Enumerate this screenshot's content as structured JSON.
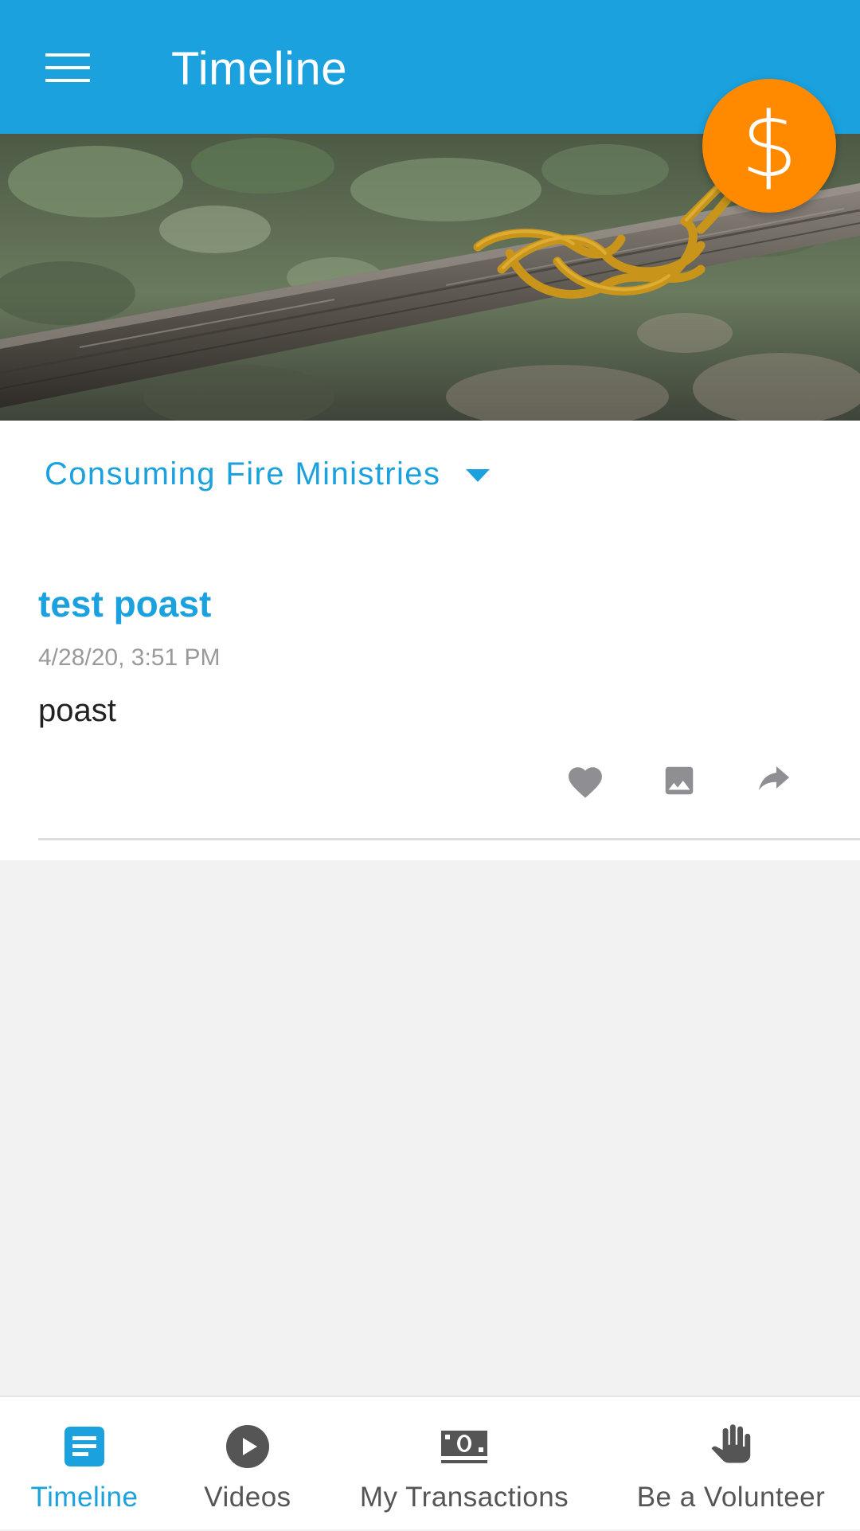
{
  "header": {
    "title": "Timeline",
    "menu_icon": "hamburger-menu-icon",
    "color": "#1ba1dd"
  },
  "hero": {
    "description_icon": "knotted-rope-on-branch-image"
  },
  "donate_button": {
    "symbol": "$",
    "icon": "dollar-icon",
    "color": "#ff8a00"
  },
  "organization": {
    "name": "Consuming Fire Ministries",
    "caret_icon": "caret-down-icon"
  },
  "posts": [
    {
      "title": "test poast",
      "date": "4/28/20, 3:51 PM",
      "body": "poast",
      "actions": [
        "heart-icon",
        "image-icon",
        "share-icon"
      ]
    }
  ],
  "bottom_nav": {
    "active_index": 0,
    "items": [
      {
        "label": "Timeline",
        "icon": "document-icon"
      },
      {
        "label": "Videos",
        "icon": "play-circle-icon"
      },
      {
        "label": "My Transactions",
        "icon": "money-icon"
      },
      {
        "label": "Be a Volunteer",
        "icon": "hand-icon"
      }
    ]
  }
}
